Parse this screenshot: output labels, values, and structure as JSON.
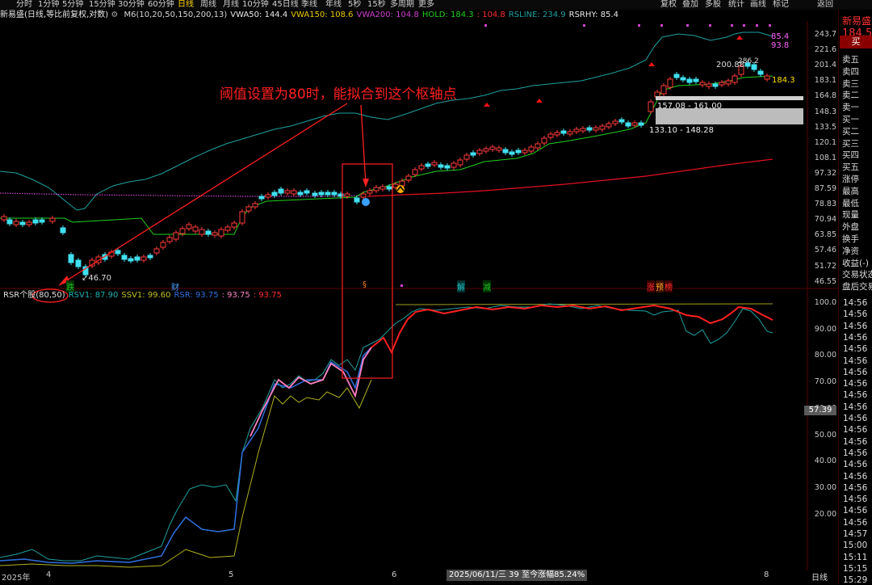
{
  "toolbar": {
    "periods": [
      "分时",
      "1分钟",
      "5分钟",
      "15分钟",
      "30分钟",
      "60分钟",
      "日线",
      "周线",
      "月线",
      "10分钟",
      "45日线",
      "季线",
      "年线",
      "5秒",
      "15秒",
      "多周期",
      "更多"
    ],
    "active_period": "日线",
    "tools": [
      "复权",
      "叠加",
      "多股",
      "统计",
      "画线",
      "标记",
      "返回"
    ]
  },
  "stock": {
    "name": "新易盛",
    "price": "184.50",
    "chart_caption": "新易盛(日线,等比前复权,对数)"
  },
  "indicators_main": [
    {
      "text": "M6(10,20,50,150,200,13)",
      "color": "#d8d8d8"
    },
    {
      "text": "VWA50: 144.4",
      "color": "#e8e8e8"
    },
    {
      "text": "VWA150: 108.6",
      "color": "#e8c800"
    },
    {
      "text": "VWA200: 104.8",
      "color": "#d040d0"
    },
    {
      "text": "HOLD: 184.3",
      "color": "#20d020"
    },
    {
      "text": ": 104.8",
      "color": "#ff3030"
    },
    {
      "text": "RSLINE: 234.9",
      "color": "#20a0a0"
    },
    {
      "text": "RSRHY: 85.4",
      "color": "#e8e8e8"
    }
  ],
  "indicators_sub": [
    {
      "text": "RSR个股(80,50)",
      "color": "#e0e0e0"
    },
    {
      "text": "RSV1: 87.90",
      "color": "#20b0b0"
    },
    {
      "text": "SSV1: 99.60",
      "color": "#c0c020"
    },
    {
      "text": "RSR: 93.75",
      "color": "#3070e0"
    },
    {
      "text": ": 93.75",
      "color": "#ff80c0"
    },
    {
      "text": ": 93.75",
      "color": "#ff3030"
    }
  ],
  "annotation": "阈值设置为80时，能拟合到这个枢轴点",
  "price_axis": [
    "243.7",
    "221.6",
    "201.4",
    "183.1",
    "164.8",
    "148.3",
    "133.5",
    "120.1",
    "108.1",
    "97.32",
    "87.59",
    "78.83",
    "70.94",
    "63.85",
    "57.46",
    "51.72",
    "46.55"
  ],
  "sub_axis": [
    "100.0",
    "90.00",
    "80.00",
    "70.00",
    "60.00",
    "50.00",
    "40.00",
    "30.00",
    "20.00"
  ],
  "sub_axis_marker": "57.39",
  "price_labels": {
    "low": "46.70",
    "high": "200.88",
    "high2": "286.2",
    "rs_right": "85.4",
    "rs_right2": "93.8",
    "hold_right": "184.3",
    "zone1": "157.08 - 161.00",
    "zone2": "133.10 - 148.28"
  },
  "event_marks": [
    "跌",
    "财",
    "§",
    "解",
    "减",
    "涨",
    "预",
    "榜"
  ],
  "x_axis": {
    "year": "2025年",
    "months": [
      "4",
      "5",
      "6",
      "8"
    ],
    "cursor_info": "2025/06/11/三 39 至今涨幅85.24%",
    "period": "日线"
  },
  "sidebar": {
    "orderbook": [
      "卖五",
      "卖四",
      "卖三",
      "卖二",
      "卖一",
      "买一",
      "买二",
      "买三",
      "买四",
      "买五"
    ],
    "stats": [
      "涨停",
      "最高",
      "最低",
      "现量",
      "外盘",
      "换手",
      "净资",
      "收益(-)",
      "交易状态",
      "盘后交易"
    ],
    "buy_button": "买",
    "times": [
      "14:56",
      "14:56",
      "14:56",
      "14:56",
      "14:56",
      "14:56",
      "14:56",
      "14:56",
      "14:56",
      "14:56",
      "14:56",
      "14:56",
      "14:56",
      "14:56",
      "14:56",
      "14:56",
      "14:56",
      "14:56",
      "14:56",
      "14:56",
      "14:57",
      "15:00",
      "15:11",
      "15:15",
      "15:29"
    ]
  },
  "colors": {
    "up": "#ff3b3b",
    "down": "#40e0f0",
    "hold": "#20d020",
    "rsline": "#20a0a0",
    "vwa200": "#d040d0",
    "annot": "#ff2020"
  }
}
